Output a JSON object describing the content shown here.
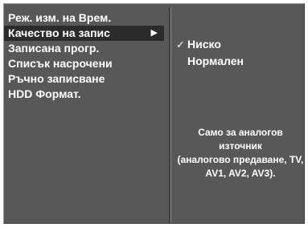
{
  "menu": {
    "items": [
      {
        "label": "Реж. изм. на Врем."
      },
      {
        "label": "Качество на запис",
        "arrow": "▶"
      },
      {
        "label": "Записана прогр."
      },
      {
        "label": "Списък насрочени"
      },
      {
        "label": "Ръчно записване"
      },
      {
        "label": "HDD Формат."
      }
    ]
  },
  "submenu": {
    "check_icon": "✓",
    "options": [
      {
        "label": "Ниско",
        "checked": true
      },
      {
        "label": "Нормален",
        "checked": false
      }
    ]
  },
  "note": {
    "lines": [
      "Само за аналогов",
      "източник",
      "(аналогово предаване, TV,",
      "AV1, AV2, AV3)."
    ]
  },
  "colors": {
    "panel": "#585858",
    "highlight": "#2b2b2b",
    "text": "#ffffff"
  }
}
